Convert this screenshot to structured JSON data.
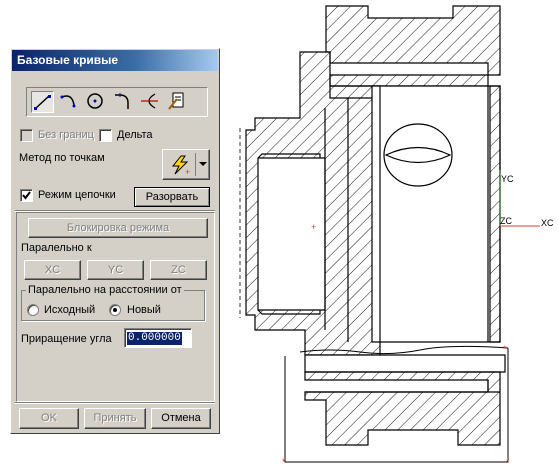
{
  "dialog": {
    "title": "Базовые кривые",
    "toolbar_icons": [
      "line-tool-icon",
      "arc-tool-icon",
      "circle-tool-icon",
      "fillet-tool-icon",
      "trim-tool-icon",
      "edit-parameters-icon"
    ],
    "no_bounds_label": "Без границ",
    "delta_label": "Дельта",
    "method_label": "Метод по точкам",
    "chain_mode_label": "Режим цепочки",
    "chain_mode_checked": true,
    "break_button": "Разорвать",
    "lock_mode_button": "Блокировка режима",
    "parallel_to_label": "Паралельно к",
    "axis_buttons": [
      "XC",
      "YC",
      "ZC"
    ],
    "parallel_distance_group": "Паралельно на расстоянии от",
    "option_original": "Исходный",
    "option_new": "Новый",
    "selected_option": "new",
    "angle_increment_label": "Приращение угла",
    "angle_increment_value": "0.000000",
    "ok_button": "OK",
    "apply_button": "Принять",
    "cancel_button": "Отмена"
  },
  "viewport": {
    "axis_labels": {
      "yc": "YC",
      "zc": "ZC",
      "xc": "XC"
    },
    "colors": {
      "axis": "#2e7d32",
      "marker": "#e53935",
      "geometry": "#000000"
    }
  }
}
